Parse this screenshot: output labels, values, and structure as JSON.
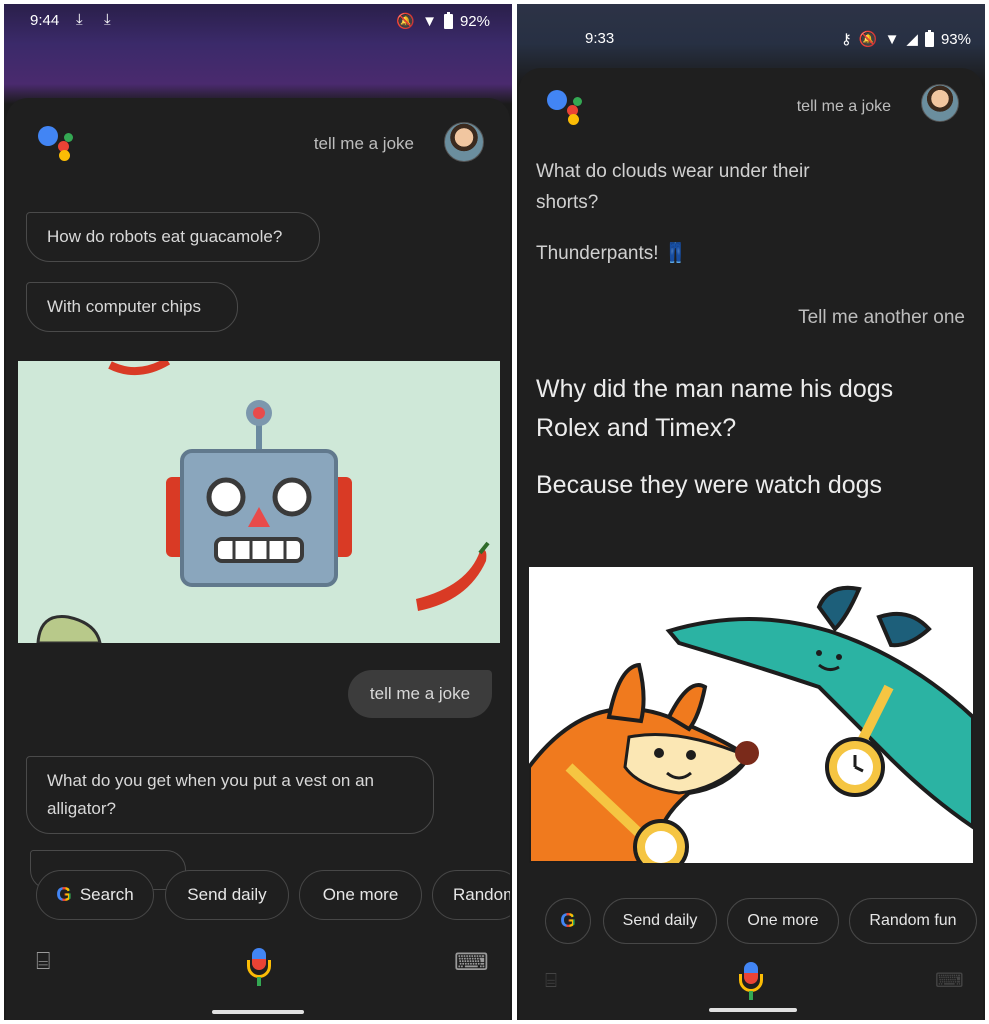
{
  "left": {
    "status": {
      "time": "9:44",
      "battery": "92%"
    },
    "query": "tell me a joke",
    "messages": {
      "joke1_question": "How do robots eat guacamole?",
      "joke1_answer": "With computer chips",
      "user_request": "tell me a joke",
      "joke2_question": "What do you get when you put a vest on an alligator?"
    },
    "chips": [
      "Search",
      "Send daily",
      "One more",
      "Random"
    ],
    "icons": {
      "bottom_left": "suggestions-tray-icon",
      "bottom_center": "microphone-icon",
      "bottom_right": "keyboard-icon"
    }
  },
  "right": {
    "status": {
      "time": "9:33",
      "battery": "93%"
    },
    "query": "tell me a joke",
    "messages": {
      "joke1_question": "What do clouds wear under their shorts?",
      "joke1_answer": "Thunderpants! 👖",
      "user_request": "Tell me another one",
      "joke2_question": "Why did the man name his dogs Rolex and Timex?",
      "joke2_answer": "Because they were watch dogs"
    },
    "chips": [
      "Send daily",
      "One more",
      "Random fun"
    ],
    "icons": {
      "bottom_center": "microphone-icon"
    }
  },
  "colors": {
    "google_blue": "#4285f4",
    "google_red": "#ea4335",
    "google_yellow": "#fbbc05",
    "google_green": "#34a853",
    "sheet_bg": "#1f1f1f"
  }
}
